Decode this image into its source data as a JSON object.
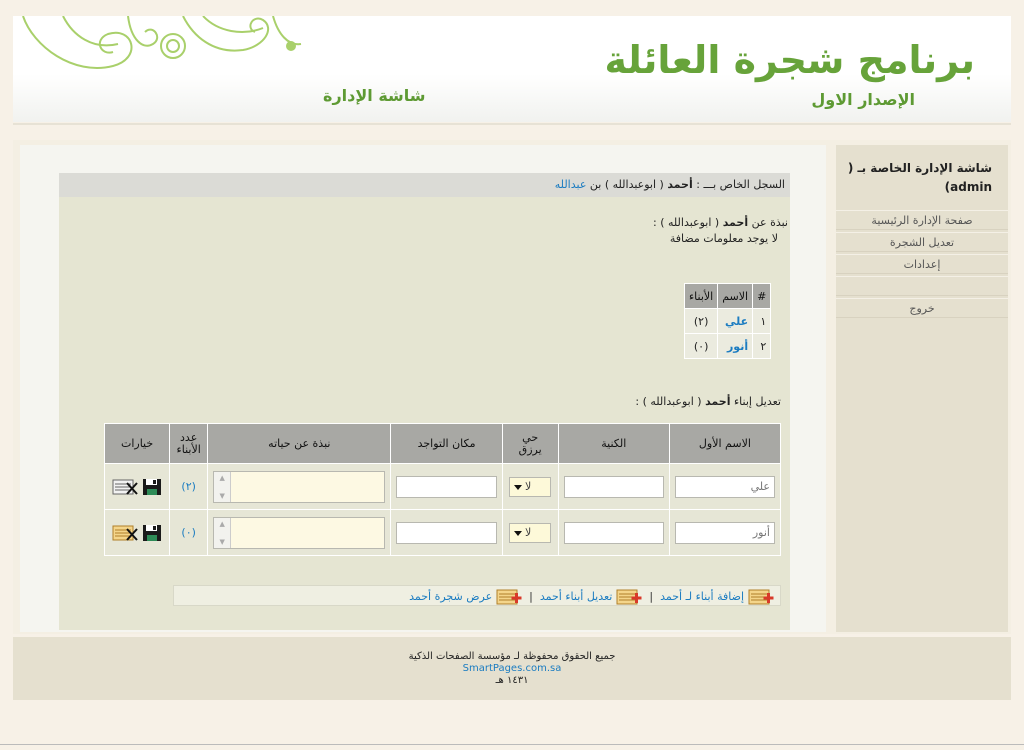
{
  "header": {
    "title": "برنامج شجرة العائلة",
    "version": "الإصدار الاول",
    "screen_name": "شاشة الإدارة"
  },
  "record": {
    "prefix": "السجل الخاص بـــ :",
    "name": "أحمد",
    "nickname": "( ابوعبدالله )",
    "son_of": "بن",
    "father": "عبدالله"
  },
  "about": {
    "label": "نبذة عن",
    "name": "أحمد",
    "nickname": "( ابوعبدالله ) :",
    "text": "لا يوجد معلومات مضافة"
  },
  "children_table": {
    "headers": [
      "#",
      "الاسم",
      "الأبناء"
    ],
    "rows": [
      {
        "num": "١",
        "name": "علي",
        "count": "(٢)"
      },
      {
        "num": "٢",
        "name": "أنور",
        "count": "(٠)"
      }
    ]
  },
  "edit_section": {
    "label": "تعديل إبناء",
    "name": "أحمد",
    "nickname": "( ابوعبدالله ) :",
    "headers": {
      "first_name": "الاسم الأول",
      "kunya": "الكنية",
      "alive": "حي يرزق",
      "location": "مكان التواجد",
      "bio": "نبذة عن حياته",
      "kids_count": "عدد الأبناء",
      "options": "خيارات"
    },
    "rows": [
      {
        "first_name": "علي",
        "kunya": "",
        "alive": "لا",
        "location": "",
        "bio": "",
        "kids_count": "(٢)"
      },
      {
        "first_name": "أنور",
        "kunya": "",
        "alive": "لا",
        "location": "",
        "bio": "",
        "kids_count": "(٠)"
      }
    ]
  },
  "actions": {
    "add_children": "إضافة أبناء لـ أحمد",
    "edit_children": "تعديل أبناء أحمد",
    "view_tree": "عرض شجرة أحمد",
    "separator": "|"
  },
  "sidebar": {
    "title": "شاشة الإدارة الخاصة بـ ( admin)",
    "items": [
      {
        "label": "صفحة الإدارة الرئيسية"
      },
      {
        "label": "تعديل الشجرة"
      },
      {
        "label": "إعدادات"
      },
      {
        "label": ""
      },
      {
        "label": "خروج"
      }
    ]
  },
  "footer": {
    "line1": "جميع الحقوق محفوظة لـ مؤسسة الصفحات الذكية",
    "line2": "SmartPages.com.sa",
    "line3": "١٤٣١ هـ"
  },
  "colors": {
    "brand_green": "#67a33a",
    "link_blue": "#1b7cc1",
    "table_header": "#a8a8a4"
  },
  "icons": {
    "save": "floppy-disk-icon",
    "edit_list": "edit-list-icon",
    "add_list": "add-list-icon"
  }
}
